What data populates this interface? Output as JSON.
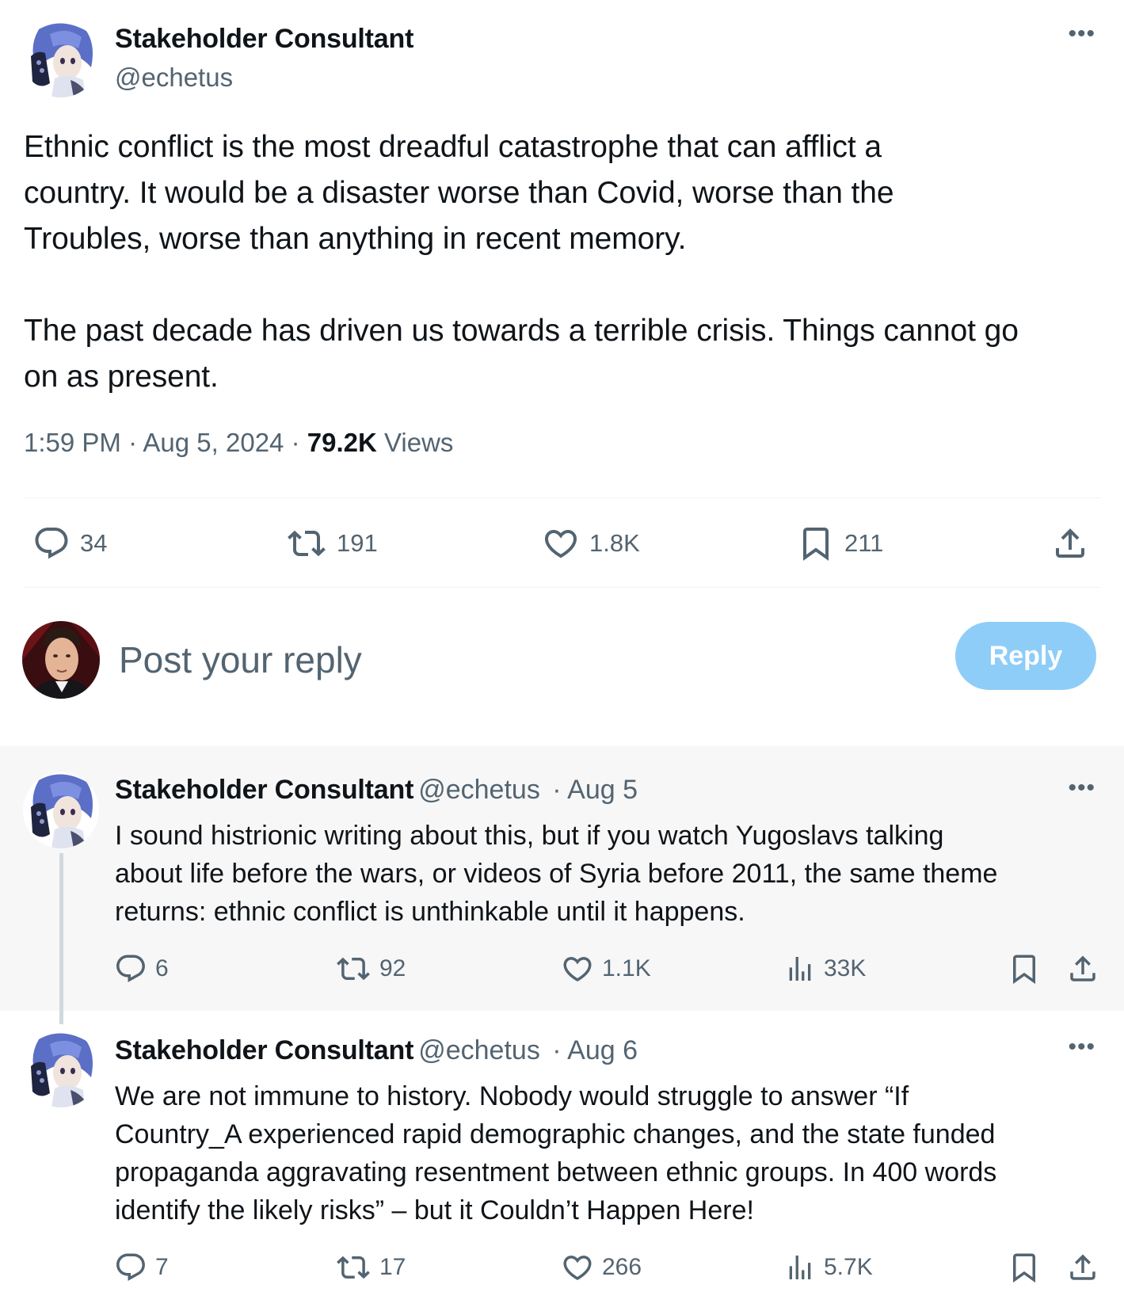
{
  "main_tweet": {
    "author_name": "Stakeholder Consultant",
    "author_handle": "@echetus",
    "more_icon": "more-horizontal-icon",
    "body": "Ethnic conflict is the most dreadful catastrophe that can afflict a\ncountry. It would be a disaster worse than Covid, worse than the\nTroubles, worse than anything in recent memory.\n\nThe past decade has driven us towards a terrible crisis. Things cannot go\non as present.",
    "time": "1:59 PM",
    "date": "Aug 5, 2024",
    "views_count": "79.2K",
    "views_label": "Views",
    "actions": {
      "replies": "34",
      "reposts": "191",
      "likes": "1.8K",
      "bookmarks": "211"
    }
  },
  "reply_composer": {
    "placeholder": "Post your reply",
    "button_label": "Reply",
    "button_color": "#8ecdf8"
  },
  "thread": [
    {
      "author_name": "Stakeholder Consultant",
      "author_handle": "@echetus",
      "date": "Aug 5",
      "body": "I sound histrionic writing about this, but if you watch Yugoslavs talking\nabout life before the wars, or videos of Syria before 2011, the same theme\nreturns: ethnic conflict is unthinkable until it happens.",
      "actions": {
        "replies": "6",
        "reposts": "92",
        "likes": "1.1K",
        "views": "33K"
      }
    },
    {
      "author_name": "Stakeholder Consultant",
      "author_handle": "@echetus",
      "date": "Aug 6",
      "body": "We are not immune to history. Nobody would struggle to answer “If\nCountry_A experienced rapid demographic changes, and the state funded\npropaganda aggravating resentment between ethnic groups. In 400 words\nidentify the likely risks” – but it Couldn’t Happen Here!",
      "actions": {
        "replies": "7",
        "reposts": "17",
        "likes": "266",
        "views": "5.7K"
      }
    }
  ],
  "colors": {
    "text": "#0f1419",
    "secondary_text": "#536471",
    "divider": "#eff3f4",
    "thread_highlight_bg": "#f7f7f7",
    "thread_line": "#cfd9de"
  }
}
